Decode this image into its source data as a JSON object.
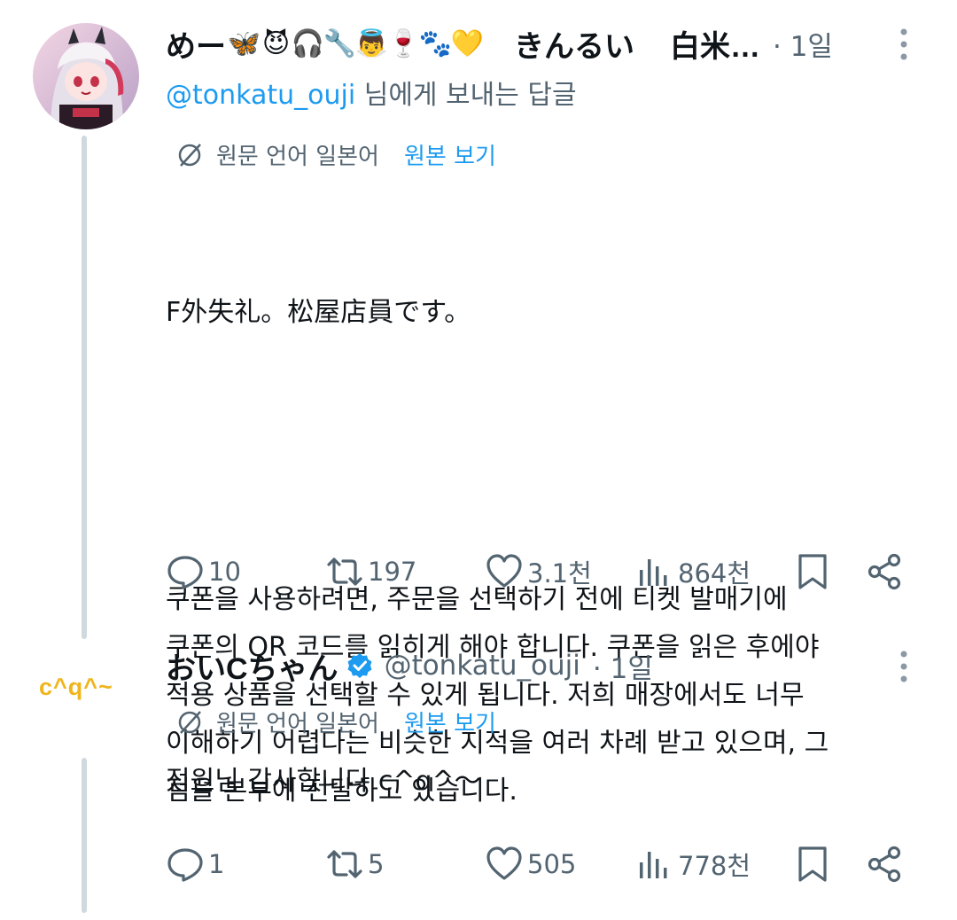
{
  "tweets": [
    {
      "display_name": "めー",
      "emojis": [
        "🦋",
        "😈",
        "🎧",
        "🔧",
        "👼",
        "🍷",
        "🐾",
        "💛"
      ],
      "name_part_2": "きんるい",
      "name_part_3": "白米…",
      "time": "· 1일",
      "reply_to_handle": "@tonkatu_ouji",
      "reply_to_suffix": " 님에게 보내는 답글",
      "translate_label": "원문 언어 일본어",
      "translate_link": "원본 보기",
      "body_line1": "F外失礼。松屋店員です。",
      "body_rest": "쿠폰을 사용하려면, 주문을 선택하기 전에 티켓 발매기에\n쿠폰의 QR 코드를 읽히게 해야 합니다. 쿠폰을 읽은 후에야\n적용 상품을 선택할 수 있게 됩니다. 저희 매장에서도 너무\n이해하기 어렵다는 비슷한 지적을 여러 차례 받고 있으며, 그\n점을 본부에 전달하고 있습니다.",
      "replies": "10",
      "retweets": "197",
      "likes": "3.1천",
      "views": "864천"
    },
    {
      "avatar_text": "c^q^~",
      "display_name": "おいCちゃん",
      "handle": "@tonkatu_ouji",
      "time": "· 1일",
      "translate_label": "원문 언어 일본어",
      "translate_link": "원본 보기",
      "body": "점원님 감사합니다 c^q^〜",
      "replies": "1",
      "retweets": "5",
      "likes": "505",
      "views": "778천"
    }
  ],
  "colors": {
    "text": "#0f1419",
    "secondary": "#536471",
    "link": "#1d9bf0",
    "thread_line": "#cfd9de",
    "avatar_text": "#f0b51a",
    "verified": "#1d9bf0"
  }
}
